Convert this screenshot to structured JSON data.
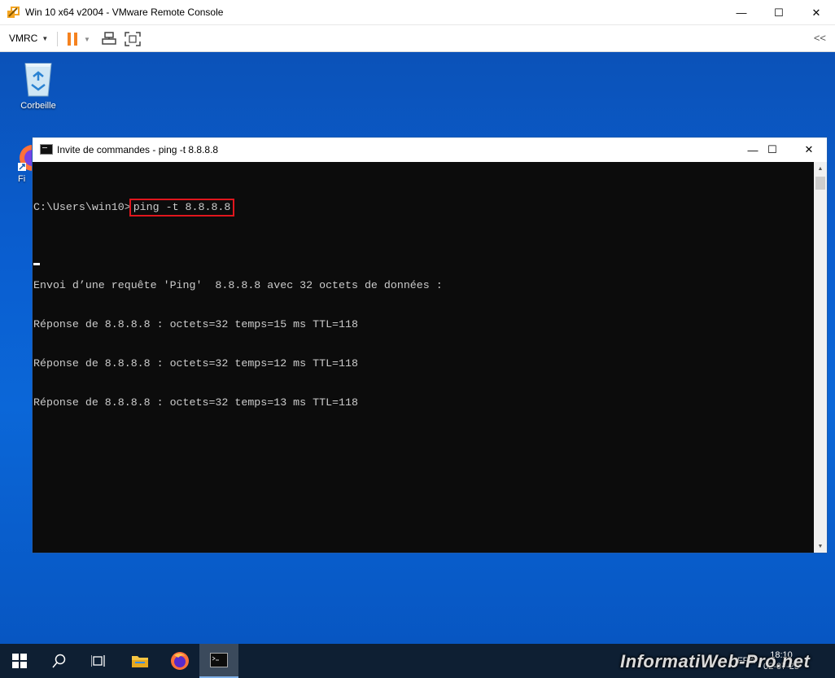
{
  "vmrc": {
    "title": "Win 10 x64 v2004 - VMware Remote Console",
    "minimize": "—",
    "maximize": "☐",
    "close": "✕",
    "menu_label": "VMRC",
    "collapse": "<<"
  },
  "desktop": {
    "icons": [
      {
        "label": "Corbeille",
        "icon": "recycle-bin-icon"
      },
      {
        "label": "Fi",
        "icon": "firefox-shortcut-icon"
      }
    ]
  },
  "cmd": {
    "title": "Invite de commandes - ping  -t 8.8.8.8",
    "prompt": "C:\\Users\\win10>",
    "command": "ping -t 8.8.8.8",
    "output": [
      "",
      "Envoi d’une requête 'Ping'  8.8.8.8 avec 32 octets de données :",
      "Réponse de 8.8.8.8 : octets=32 temps=15 ms TTL=118",
      "Réponse de 8.8.8.8 : octets=32 temps=12 ms TTL=118",
      "Réponse de 8.8.8.8 : octets=32 temps=13 ms TTL=118"
    ],
    "highlight_color": "#e0161d"
  },
  "taskbar": {
    "apps": [
      {
        "name": "start",
        "icon": "windows-start-icon"
      },
      {
        "name": "search",
        "icon": "search-icon"
      },
      {
        "name": "task-view",
        "icon": "task-view-icon"
      },
      {
        "name": "file-explorer",
        "icon": "folder-icon"
      },
      {
        "name": "firefox",
        "icon": "firefox-icon"
      },
      {
        "name": "command-prompt",
        "icon": "cmd-icon"
      }
    ],
    "lang": "FRA",
    "time": "18:10",
    "date": "02-07-23"
  },
  "watermark": "InformatiWeb-Pro.net",
  "colors": {
    "desktop": "#0a5ed0",
    "taskbar": "#0e1f33",
    "terminal_bg": "#0c0c0c",
    "terminal_fg": "#cccccc",
    "pause_orange": "#f5821f"
  }
}
